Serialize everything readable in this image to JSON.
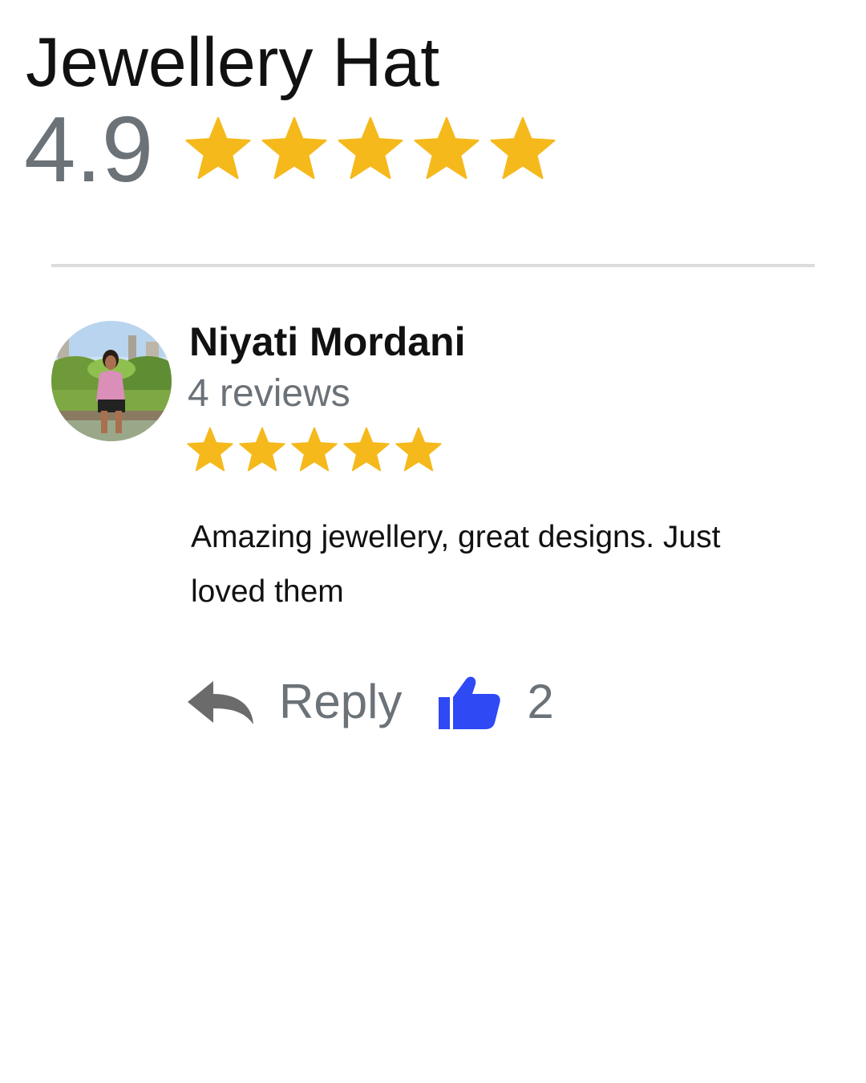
{
  "business": {
    "name": "Jewellery Hat",
    "rating": "4.9",
    "star_color": "#f5b91c"
  },
  "review": {
    "reviewer_name": "Niyati Mordani",
    "review_count": "4 reviews",
    "rating": 5,
    "text": "Amazing jewellery, great designs. Just loved them",
    "actions": {
      "reply_label": "Reply",
      "like_count": "2"
    }
  },
  "icons": {
    "reply": "reply-arrow-icon",
    "like": "thumbs-up-icon",
    "star": "star-icon"
  },
  "colors": {
    "like_icon": "#2f49f5",
    "reply_icon": "#6b6b6b",
    "muted_text": "#6b7278"
  }
}
